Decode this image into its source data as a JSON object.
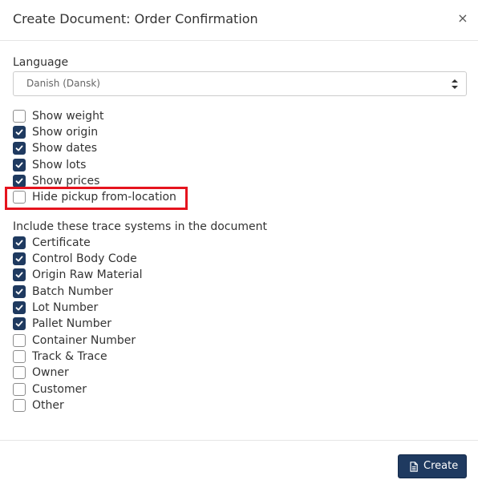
{
  "header": {
    "title": "Create Document: Order Confirmation",
    "close_label": "×"
  },
  "language": {
    "label": "Language",
    "selected": "Danish (Dansk)"
  },
  "options": [
    {
      "label": "Show weight",
      "checked": false
    },
    {
      "label": "Show origin",
      "checked": true
    },
    {
      "label": "Show dates",
      "checked": true
    },
    {
      "label": "Show lots",
      "checked": true
    },
    {
      "label": "Show prices",
      "checked": true
    },
    {
      "label": "Hide pickup from-location",
      "checked": false
    }
  ],
  "trace": {
    "heading": "Include these trace systems in the document",
    "items": [
      {
        "label": "Certificate",
        "checked": true
      },
      {
        "label": "Control Body Code",
        "checked": true
      },
      {
        "label": "Origin Raw Material",
        "checked": true
      },
      {
        "label": "Batch Number",
        "checked": true
      },
      {
        "label": "Lot Number",
        "checked": true
      },
      {
        "label": "Pallet Number",
        "checked": true
      },
      {
        "label": "Container Number",
        "checked": false
      },
      {
        "label": "Track & Trace",
        "checked": false
      },
      {
        "label": "Owner",
        "checked": false
      },
      {
        "label": "Customer",
        "checked": false
      },
      {
        "label": "Other",
        "checked": false
      }
    ]
  },
  "footer": {
    "create_label": "Create",
    "create_icon": "document-icon"
  },
  "colors": {
    "primary": "#1f3a60",
    "highlight": "#e5141e"
  }
}
